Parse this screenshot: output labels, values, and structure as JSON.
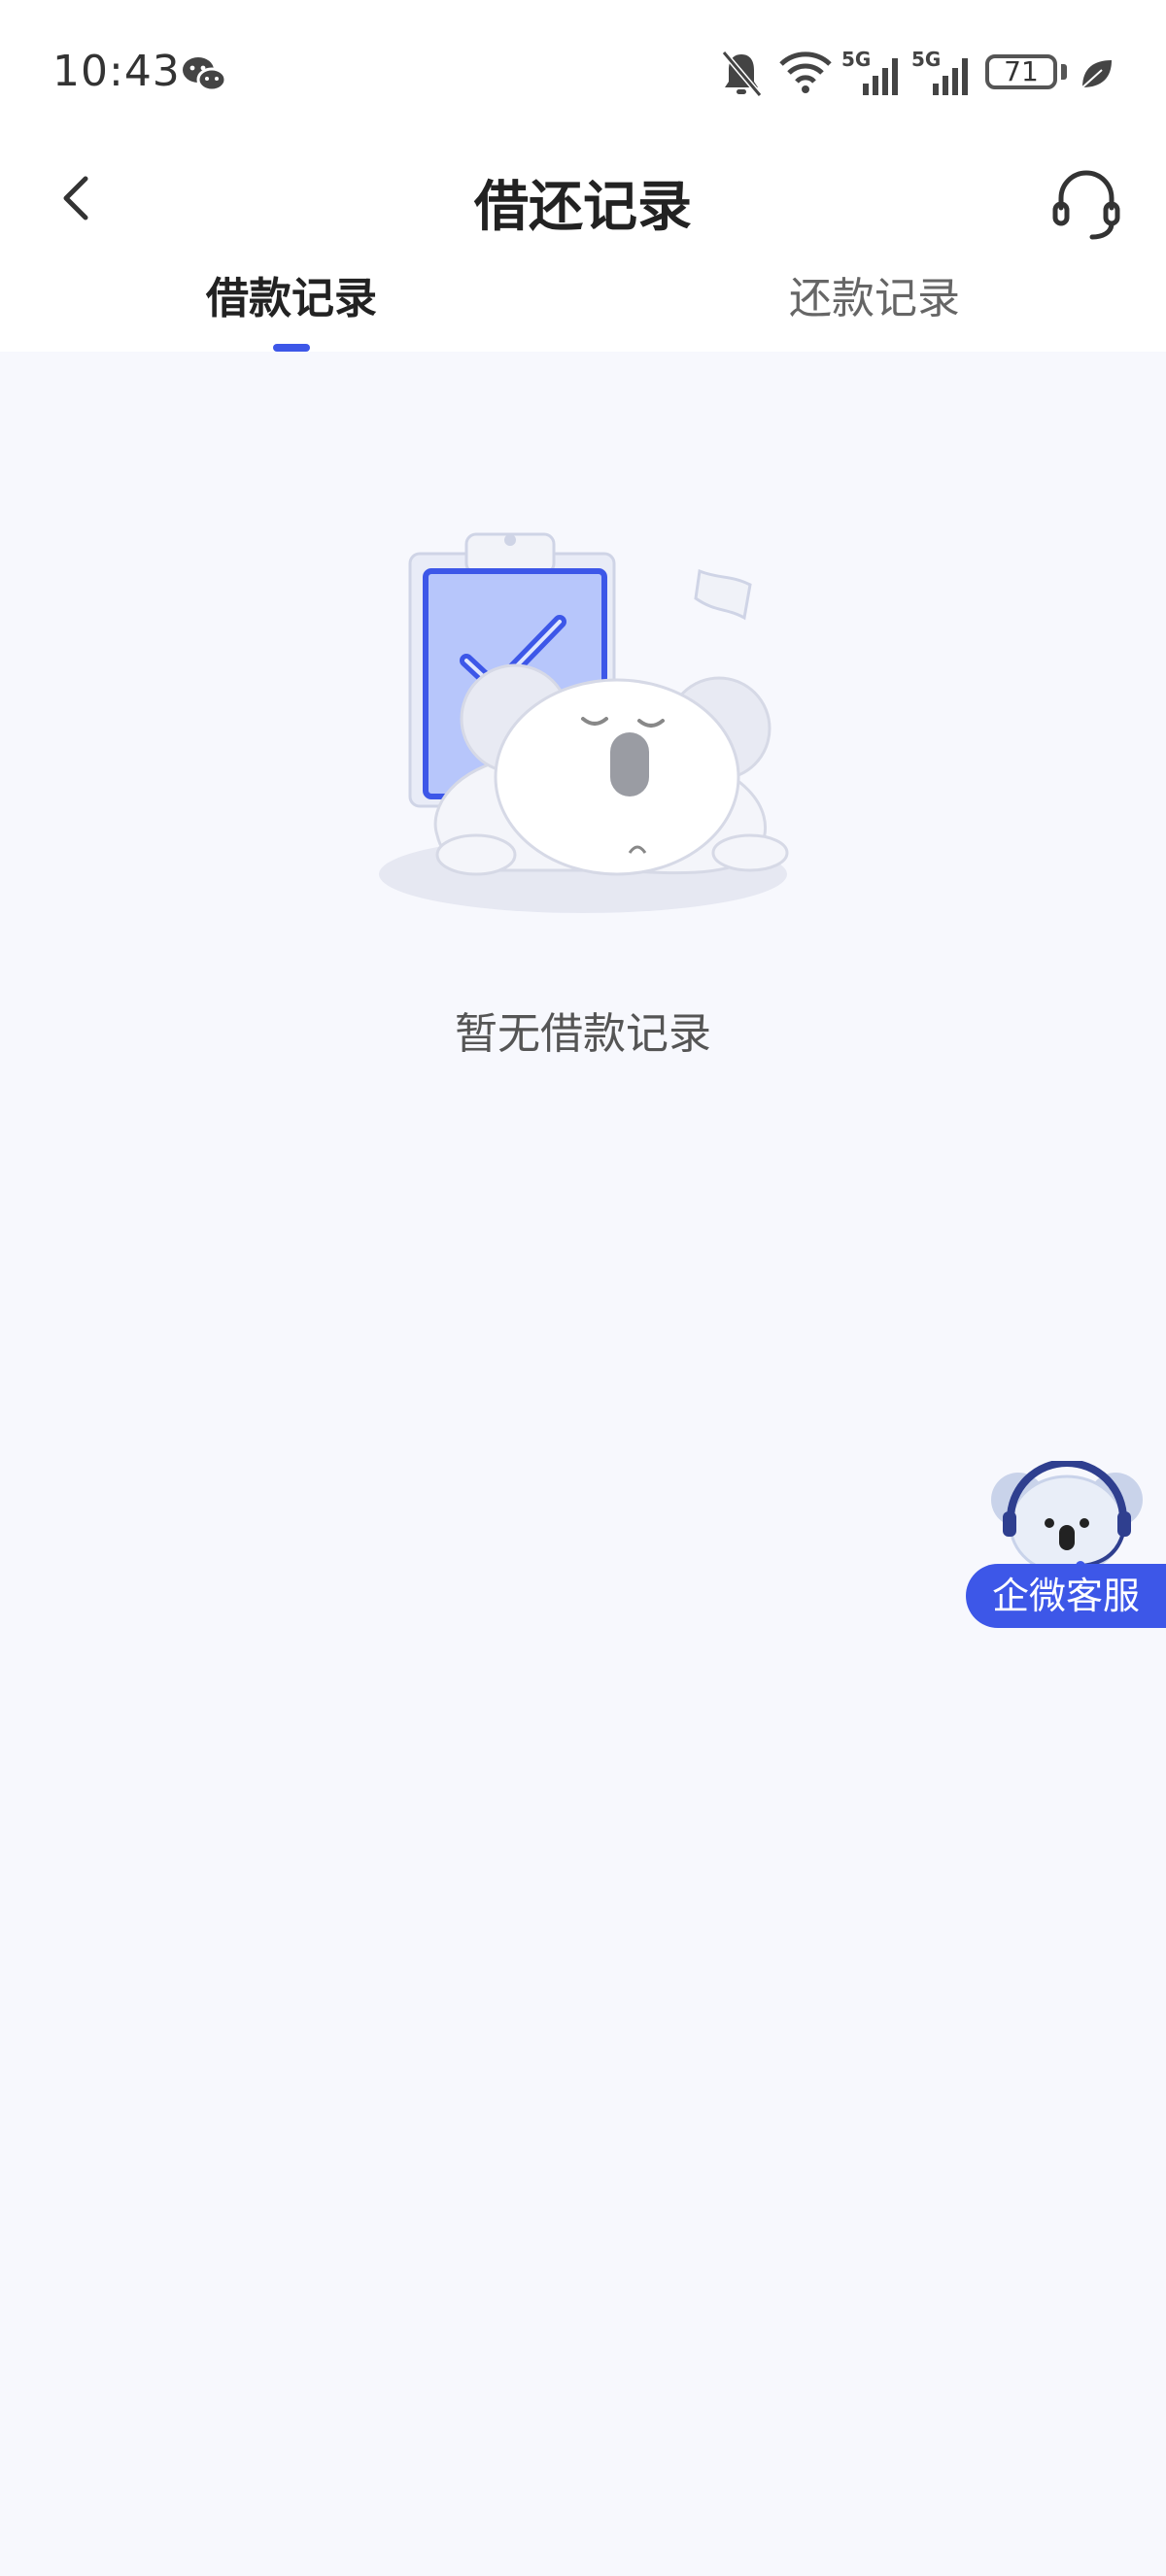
{
  "status_bar": {
    "time": "10:43",
    "battery": "71",
    "network_1": "5G",
    "network_2": "5G",
    "icons": [
      "wechat-icon",
      "mute-bell-icon",
      "wifi-icon",
      "signal-icon",
      "signal-icon",
      "battery-icon",
      "leaf-icon"
    ]
  },
  "header": {
    "title": "借还记录",
    "back_icon": "chevron-left-icon",
    "support_icon": "headset-icon"
  },
  "tabs": [
    {
      "label": "借款记录",
      "active": true
    },
    {
      "label": "还款记录",
      "active": false
    }
  ],
  "empty_state": {
    "message": "暂无借款记录",
    "illustration": "sleeping-koala-clipboard"
  },
  "floating_service": {
    "label": "企微客服"
  },
  "colors": {
    "accent": "#3d57e8",
    "background": "#f7f8fd",
    "header_bg": "#ffffff"
  }
}
